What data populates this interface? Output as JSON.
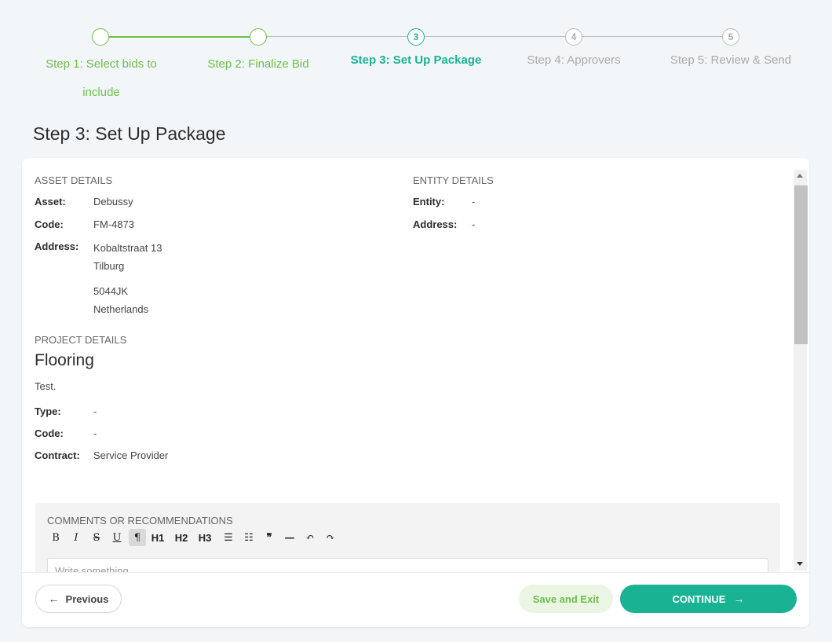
{
  "stepper": {
    "steps": [
      {
        "number": "",
        "label": "Step 1: Select bids to include",
        "state": "done"
      },
      {
        "number": "",
        "label": "Step 2: Finalize Bid",
        "state": "done"
      },
      {
        "number": "3",
        "label": "Step 3: Set Up Package",
        "state": "active"
      },
      {
        "number": "4",
        "label": "Step 4: Approvers",
        "state": "pending"
      },
      {
        "number": "5",
        "label": "Step 5: Review & Send",
        "state": "pending"
      }
    ]
  },
  "page_title": "Step 3: Set Up Package",
  "asset": {
    "section_label": "ASSET DETAILS",
    "asset_key": "Asset:",
    "asset_val": "Debussy",
    "code_key": "Code:",
    "code_val": "FM-4873",
    "address_key": "Address:",
    "address_line1": "Kobaltstraat 13",
    "address_line2": "Tilburg",
    "address_line3": "5044JK",
    "address_line4": "Netherlands"
  },
  "entity": {
    "section_label": "ENTITY DETAILS",
    "entity_key": "Entity:",
    "entity_val": "-",
    "address_key": "Address:",
    "address_val": "-"
  },
  "project": {
    "section_label": "PROJECT DETAILS",
    "title": "Flooring",
    "description": "Test.",
    "type_key": "Type:",
    "type_val": "-",
    "code_key": "Code:",
    "code_val": "-",
    "contract_key": "Contract:",
    "contract_val": "Service Provider"
  },
  "comments": {
    "label": "COMMENTS OR RECOMMENDATIONS",
    "placeholder": "Write something ...",
    "toolbar": {
      "bold": "B",
      "italic": "I",
      "strike": "S",
      "underline": "U",
      "paragraph": "¶",
      "h1": "H1",
      "h2": "H2",
      "h3": "H3",
      "bullet": "☰",
      "ordered": "☷",
      "quote": "❞",
      "rule": "—",
      "undo": "↶",
      "redo": "↷"
    }
  },
  "footer": {
    "previous_label": "Previous",
    "save_label": "Save and Exit",
    "continue_label": "CONTINUE"
  },
  "colors": {
    "done": "#6cc04a",
    "active": "#19b394",
    "pending": "#b8bcc0"
  }
}
